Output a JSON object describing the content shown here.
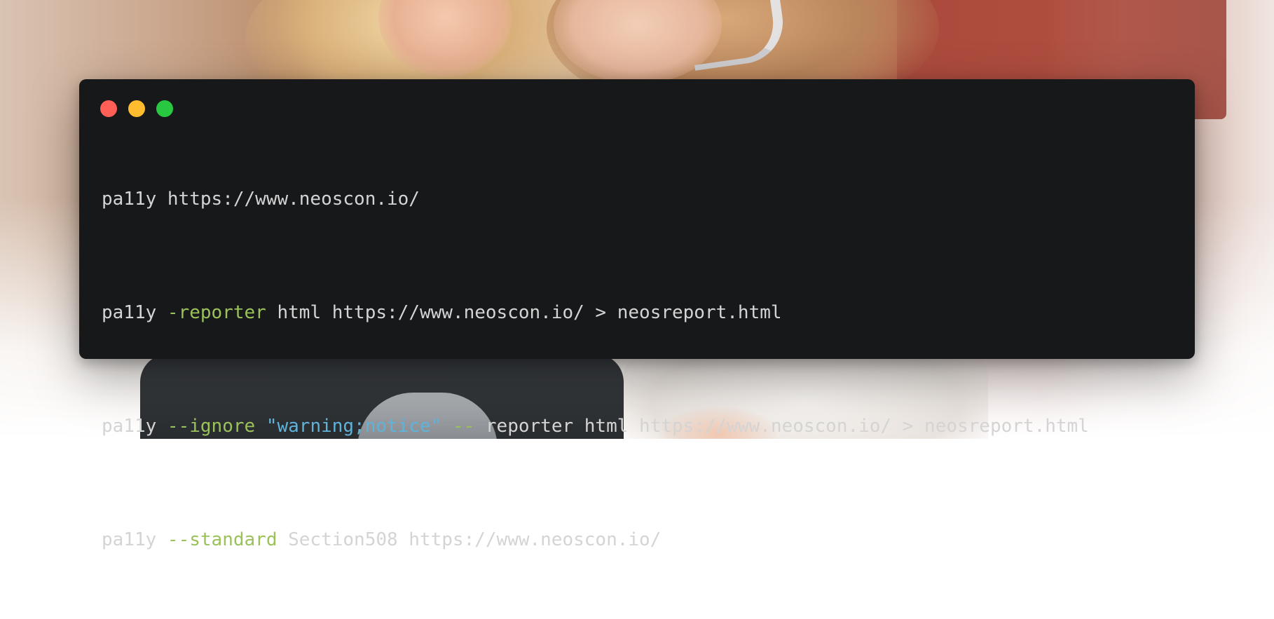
{
  "colors": {
    "terminal_background": "#17181a",
    "window_close": "#ff5f57",
    "window_minimize": "#febc2e",
    "window_maximize": "#28c840",
    "command_text": "#d4d4d4",
    "flag_text": "#9bc25a",
    "string_text": "#5fb3d9"
  },
  "window": {
    "controls": [
      {
        "icon": "close-icon"
      },
      {
        "icon": "minimize-icon"
      },
      {
        "icon": "maximize-icon"
      }
    ]
  },
  "code": {
    "lines": [
      {
        "command": "pa11y",
        "rest": " https://www.neoscon.io/"
      },
      {
        "command": "pa11y",
        "flag": " -reporter",
        "rest": " html https://www.neoscon.io/ > neosreport.html"
      },
      {
        "command": "pa11y",
        "flag": " --ignore",
        "string": " \"warning;notice\"",
        "flag2": " --",
        "rest": " reporter html https://www.neoscon.io/ > neosreport.html"
      },
      {
        "command": "pa11y",
        "flag": " --standard",
        "rest": " Section508 https://www.neoscon.io/"
      }
    ]
  }
}
